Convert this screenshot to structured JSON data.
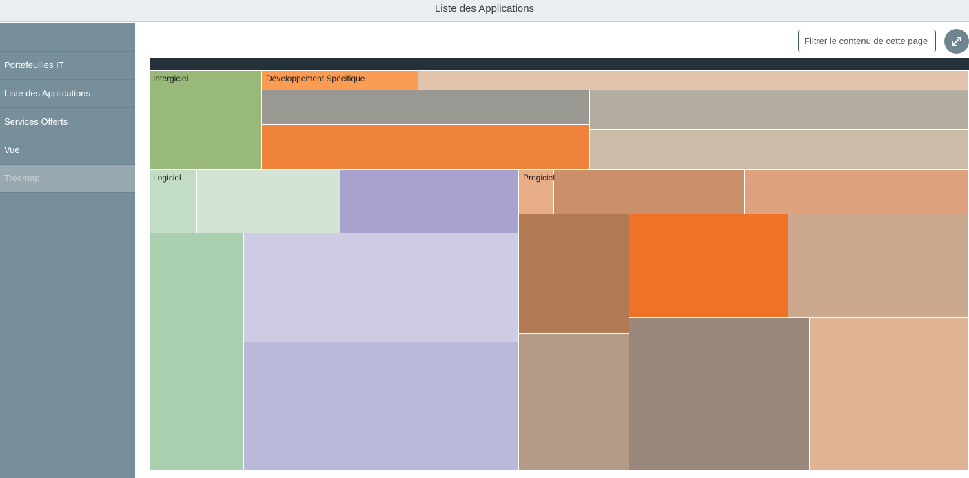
{
  "header": {
    "title": "Liste des Applications"
  },
  "sidebar": {
    "items": [
      {
        "label": "Portefeuilles IT",
        "active": false
      },
      {
        "label": "Liste des Applications",
        "active": false
      },
      {
        "label": "Services Offerts",
        "active": false
      },
      {
        "label": "Vue",
        "active": false
      },
      {
        "label": "Treemap",
        "active": true
      }
    ]
  },
  "toolbar": {
    "filter_placeholder": "Filtrer le contenu de cette page",
    "fullscreen_icon": "expand-arrows-icon"
  },
  "colors": {
    "sidebar_bg": "#778f9a",
    "treemap_header": "#243139",
    "intergiciel": "#98b97a",
    "developpement_specifique": "#f0833b",
    "logiciel": "#a8cfae",
    "progiciel": "#f07227"
  },
  "treemap": {
    "groups": [
      {
        "label": "Intergiciel"
      },
      {
        "label": "Développement Spécifique"
      },
      {
        "label": "Logiciel"
      },
      {
        "label": "Progiciel"
      }
    ]
  }
}
